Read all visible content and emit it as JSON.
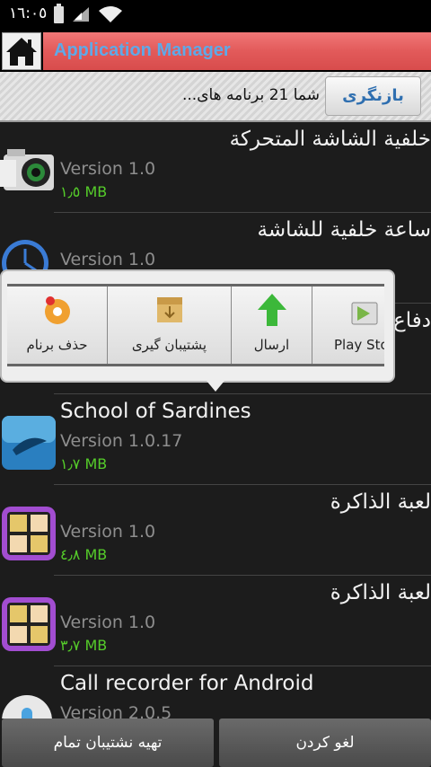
{
  "status_bar": {
    "time": "١٦:٠٥"
  },
  "header": {
    "title": "Application Manager"
  },
  "info_bar": {
    "text": "شما 21 برنامه های...",
    "refresh_label": "بازنگری"
  },
  "apps": [
    {
      "name": "خلفية الشاشة المتحركة",
      "version": "Version 1.0",
      "size": "١٫٥ MB",
      "icon": "camera-icon"
    },
    {
      "name": "ساعة خلفية للشاشة",
      "version": "Version 1.0",
      "size": "",
      "icon": "clock-icon"
    },
    {
      "name": "دفاع",
      "version": "",
      "size": "",
      "icon": ""
    },
    {
      "name": "School of Sardines",
      "version": "Version 1.0.17",
      "size": "١٫٧ MB",
      "icon": "fish-icon"
    },
    {
      "name": "لعبة الذاكرة",
      "version": "Version 1.0",
      "size": "٤٫٨ MB",
      "icon": "memory-game-icon"
    },
    {
      "name": "لعبة الذاكرة",
      "version": "Version 1.0",
      "size": "٣٫٧ MB",
      "icon": "memory-game-icon"
    },
    {
      "name": "Call recorder for Android",
      "version": "Version 2.0.5",
      "size": "",
      "icon": "microphone-icon"
    }
  ],
  "popup": {
    "items": [
      {
        "label": "حذف برنام",
        "icon": "uninstall-icon"
      },
      {
        "label": "پشتیبان گیری",
        "icon": "backup-box-icon"
      },
      {
        "label": "ارسال",
        "icon": "send-arrow-icon"
      },
      {
        "label": "Play Sto",
        "icon": "play-store-icon"
      }
    ]
  },
  "bottom_bar": {
    "left_button": "تهیه نشتیبان تمام",
    "right_button": "لغو کردن"
  }
}
